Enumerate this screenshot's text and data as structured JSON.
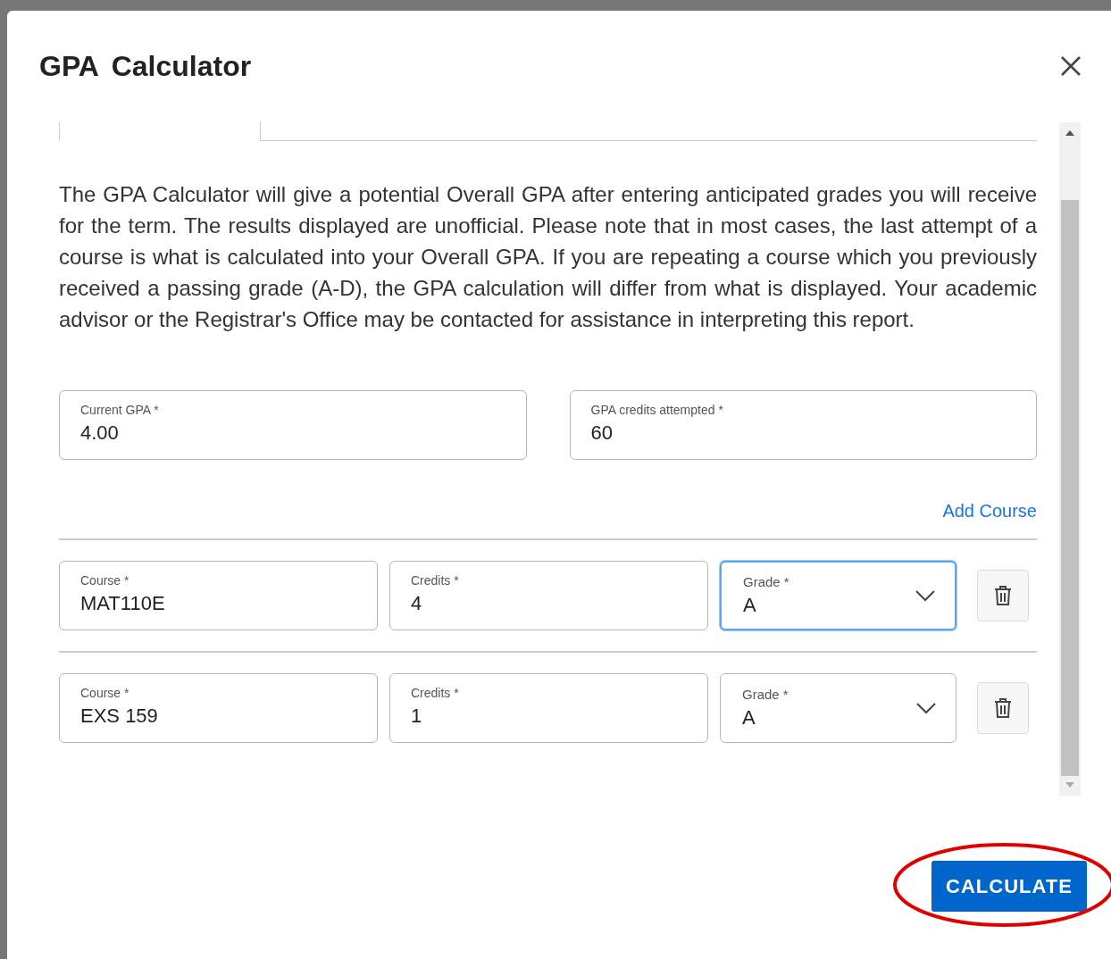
{
  "dialog": {
    "title": "GPA Calculator",
    "description": "The GPA Calculator will give a potential Overall GPA after entering anticipated grades you will receive for the term. The results displayed are unofficial. Please note that in most cases, the last attempt of a course is what is calculated into your Overall GPA. If you are repeating a course which you previously received a passing grade (A-D), the GPA calculation will differ from what is displayed. Your academic advisor or the Registrar's Office may be contacted for assistance in interpreting this report.",
    "fields": [
      {
        "label": "Current GPA *",
        "value": "4.00"
      },
      {
        "label": "GPA credits attempted *",
        "value": "60"
      }
    ],
    "add_course": "Add Course",
    "courses": [
      {
        "course": {
          "label": "Course *",
          "value": "MAT110E"
        },
        "credits": {
          "label": "Credits *",
          "value": "4"
        },
        "grade": {
          "label": "Grade *",
          "value": "A",
          "focused": true
        }
      },
      {
        "course": {
          "label": "Course *",
          "value": "EXS 159"
        },
        "credits": {
          "label": "Credits *",
          "value": "1"
        },
        "grade": {
          "label": "Grade *",
          "value": "A",
          "focused": false
        }
      }
    ],
    "calculate_button": "CALCULATE"
  },
  "annotation": {
    "kind": "ellipse",
    "color": "#e00000"
  }
}
